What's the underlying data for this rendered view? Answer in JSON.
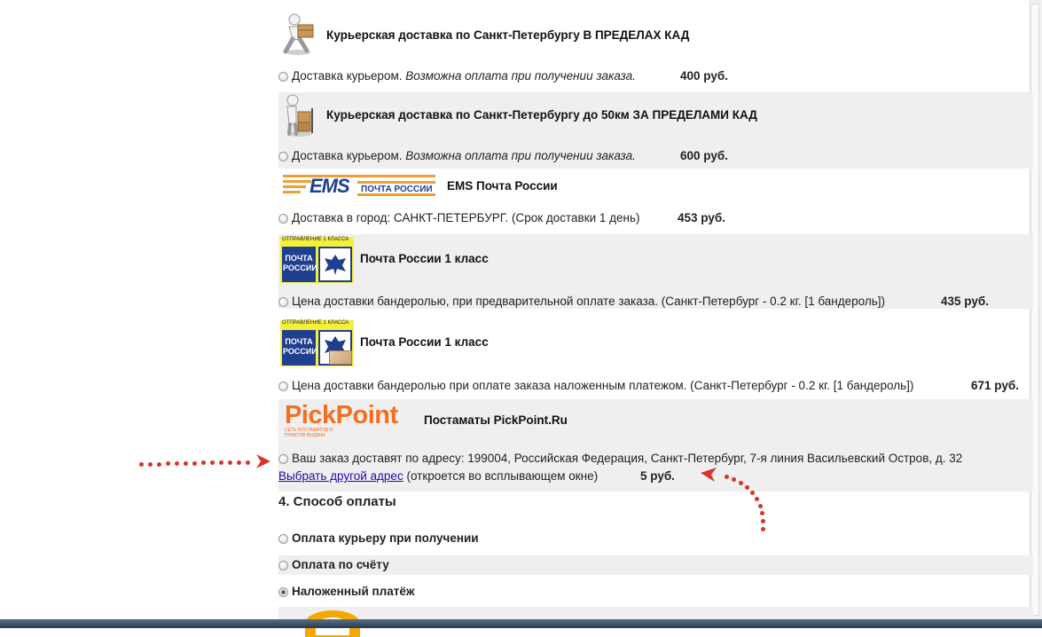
{
  "shipping": {
    "courier_in": {
      "title": "Курьерская доставка по Санкт-Петербургу В ПРЕДЕЛАХ КАД",
      "option_text": "Доставка курьером.",
      "option_note": "Возможна оплата при получении заказа.",
      "price": "400 руб."
    },
    "courier_out": {
      "title": "Курьерская доставка по Санкт-Петербургу до 50км ЗА ПРЕДЕЛАМИ КАД",
      "option_text": "Доставка курьером.",
      "option_note": "Возможна оплата при получении заказа.",
      "price": "600 руб."
    },
    "ems": {
      "logo_text": "EMS",
      "logo_subtext": "ПОЧТА РОССИИ",
      "title": "EMS Почта России",
      "option_text": "Доставка в город: САНКТ-ПЕТЕРБУРГ. (Срок доставки 1 день)",
      "price": "453 руб."
    },
    "post_prepaid": {
      "logo_top": "ОТПРАВЛЕНИЕ  1  КЛАССА",
      "logo_text": "ПОЧТА РОССИИ",
      "title": "Почта России 1 класс",
      "option_text": "Цена доставки бандеролью, при предварительной оплате заказа. (Санкт-Петербург - 0.2 кг. [1 бандероль])",
      "price": "435 руб."
    },
    "post_cod": {
      "logo_top": "ОТПРАВЛЕНИЕ  1  КЛАССА",
      "logo_text": "ПОЧТА РОССИИ",
      "title": "Почта России 1 класс",
      "option_text": "Цена доставки бандеролью при оплате заказа наложенным платежом. (Санкт-Петербург - 0.2 кг. [1 бандероль])",
      "price": "671 руб."
    },
    "pickpoint": {
      "logo_text": "PickPoint",
      "logo_tagline": "СЕТЬ ПОСТАМАТОВ И ПУНКТОВ ВЫДАЧИ",
      "title": "Постаматы PickPoint.Ru",
      "option_text": "Ваш заказ доставят по адресу: 199004, Российская Федерация, Санкт-Петербург, 7-я линия Васильевский Остров, д. 32",
      "change_link": "Выбрать другой адрес",
      "change_note": "(откроется во всплывающем окне)",
      "price": "5 руб."
    }
  },
  "payment": {
    "section_title": "4.  Способ оплаты",
    "options": [
      {
        "label": "Оплата курьеру при получении",
        "selected": false
      },
      {
        "label": "Оплата по счёту",
        "selected": false
      },
      {
        "label": "Наложенный платёж",
        "selected": true
      }
    ]
  },
  "colors": {
    "arrow": "#d9332a",
    "ems_orange": "#f0a030",
    "ems_blue": "#1c3f94",
    "post_blue": "#1f3f8f",
    "pickpoint_orange": "#f36f21",
    "link": "#1a0dab"
  }
}
